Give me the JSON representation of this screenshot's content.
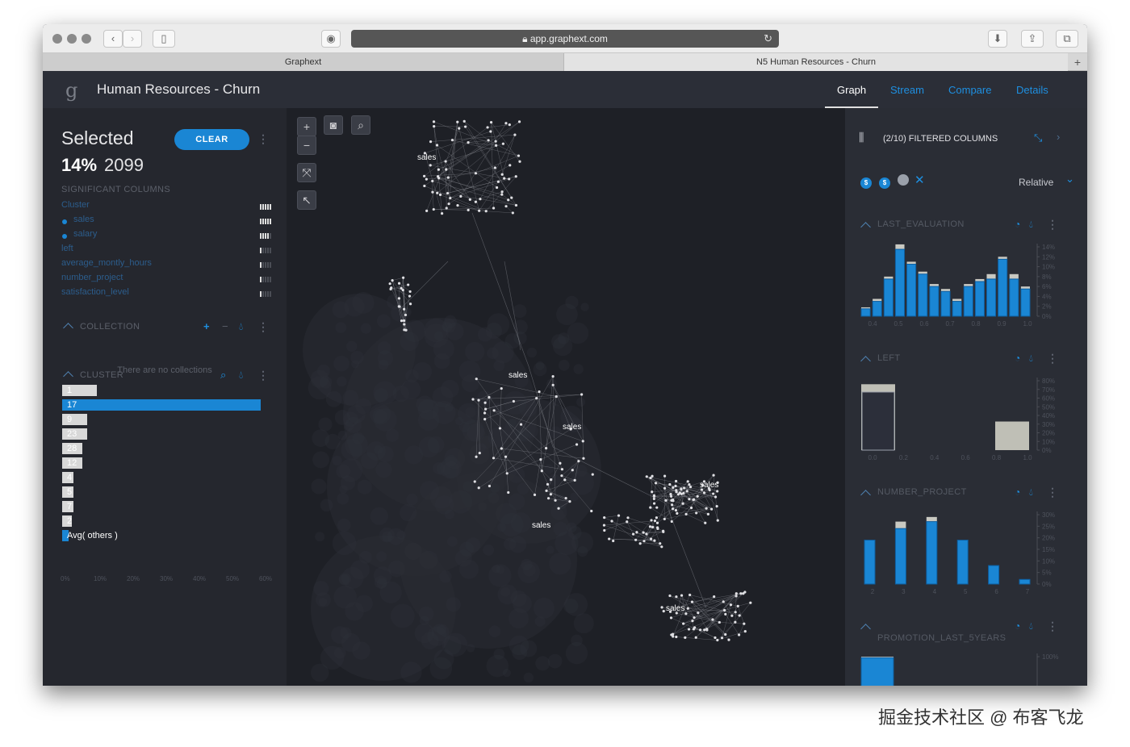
{
  "browser": {
    "url": "app.graphext.com",
    "tabs": [
      "Graphext",
      "N5 Human Resources - Churn"
    ],
    "new_tab": "+"
  },
  "app": {
    "logo": "g",
    "title": "Human Resources - Churn",
    "nav": [
      "Graph",
      "Stream",
      "Compare",
      "Details"
    ],
    "active_nav": "Graph",
    "accent_color": "#1a86d4"
  },
  "selection": {
    "title": "Selected",
    "percent": "14%",
    "count": "2099",
    "clear_label": "CLEAR",
    "significant_header": "SIGNIFICANT COLUMNS",
    "significant_columns": [
      {
        "label": "Cluster",
        "level": 5,
        "dot": false
      },
      {
        "label": "sales",
        "level": 5,
        "dot": true
      },
      {
        "label": "salary",
        "level": 4,
        "dot": true
      },
      {
        "label": "left",
        "level": 1,
        "dot": false
      },
      {
        "label": "average_montly_hours",
        "level": 1,
        "dot": false
      },
      {
        "label": "number_project",
        "level": 1,
        "dot": false
      },
      {
        "label": "satisfaction_level",
        "level": 1,
        "dot": false
      }
    ]
  },
  "collection": {
    "header": "COLLECTION",
    "empty_text": "There are no collections"
  },
  "cluster": {
    "header": "CLUSTER",
    "rows": [
      {
        "label": "1",
        "value": 10.5,
        "selected": false
      },
      {
        "label": "17",
        "value": 60,
        "selected": true
      },
      {
        "label": "9",
        "value": 7.5,
        "selected": false
      },
      {
        "label": "23",
        "value": 7.5,
        "selected": false
      },
      {
        "label": "28",
        "value": 6,
        "selected": false
      },
      {
        "label": "12",
        "value": 6,
        "selected": false
      },
      {
        "label": "4",
        "value": 3.5,
        "selected": false
      },
      {
        "label": "5",
        "value": 3.5,
        "selected": false
      },
      {
        "label": "7",
        "value": 3.5,
        "selected": false
      },
      {
        "label": "2",
        "value": 3,
        "selected": false
      },
      {
        "label": "Avg( others )",
        "value": 2,
        "selected": true
      }
    ],
    "axis_ticks": [
      "0%",
      "10%",
      "20%",
      "30%",
      "40%",
      "50%",
      "60%"
    ]
  },
  "graph": {
    "node_labels": [
      "sales",
      "sales",
      "sales",
      "sales",
      "sales",
      "sales"
    ]
  },
  "filters": {
    "title": "(2/10) FILTERED COLUMNS",
    "pills": [
      "$",
      "$"
    ],
    "mode": "Relative"
  },
  "histograms": [
    {
      "title": "LAST_EVALUATION",
      "x_ticks": [
        "0.4",
        "0.5",
        "0.6",
        "0.7",
        "0.8",
        "0.9",
        "1.0"
      ],
      "y_ticks": [
        "14%",
        "12%",
        "10%",
        "8%",
        "6%",
        "4%",
        "2%",
        "0%"
      ],
      "y_max": 14,
      "blue": [
        1.5,
        3,
        7.5,
        13.5,
        10.5,
        8.5,
        6,
        5,
        3,
        6,
        7,
        7.5,
        11.5,
        7.5,
        5.5
      ],
      "gray": [
        1.8,
        3.5,
        8,
        14.5,
        11,
        9,
        6.5,
        5.5,
        3.5,
        6.5,
        7.5,
        8.5,
        12,
        8.5,
        6
      ]
    },
    {
      "title": "LEFT",
      "x_ticks": [
        "0.0",
        "0.2",
        "0.4",
        "0.6",
        "0.8",
        "1.0"
      ],
      "y_ticks": [
        "80%",
        "70%",
        "60%",
        "50%",
        "40%",
        "30%",
        "20%",
        "10%",
        "0%"
      ],
      "y_max": 80,
      "bins": [
        {
          "x": "0.0",
          "blue": 67,
          "gray": 76
        },
        {
          "x": "1.0",
          "blue": 0,
          "gray": 33
        }
      ]
    },
    {
      "title": "NUMBER_PROJECT",
      "x_ticks": [
        "2",
        "3",
        "4",
        "5",
        "6",
        "7"
      ],
      "y_ticks": [
        "30%",
        "25%",
        "20%",
        "15%",
        "10%",
        "5%",
        "0%"
      ],
      "y_max": 30,
      "blue": [
        19,
        24,
        27,
        19,
        8,
        2
      ],
      "gray": [
        16,
        27,
        29,
        18,
        7,
        1.5
      ]
    },
    {
      "title": "PROMOTION_LAST_5YEARS",
      "y_ticks": [
        "100%",
        "80%"
      ],
      "y_max": 100,
      "blue": [
        98
      ],
      "gray": [
        100
      ]
    }
  ],
  "watermark": "掘金技术社区 @ 布客飞龙"
}
